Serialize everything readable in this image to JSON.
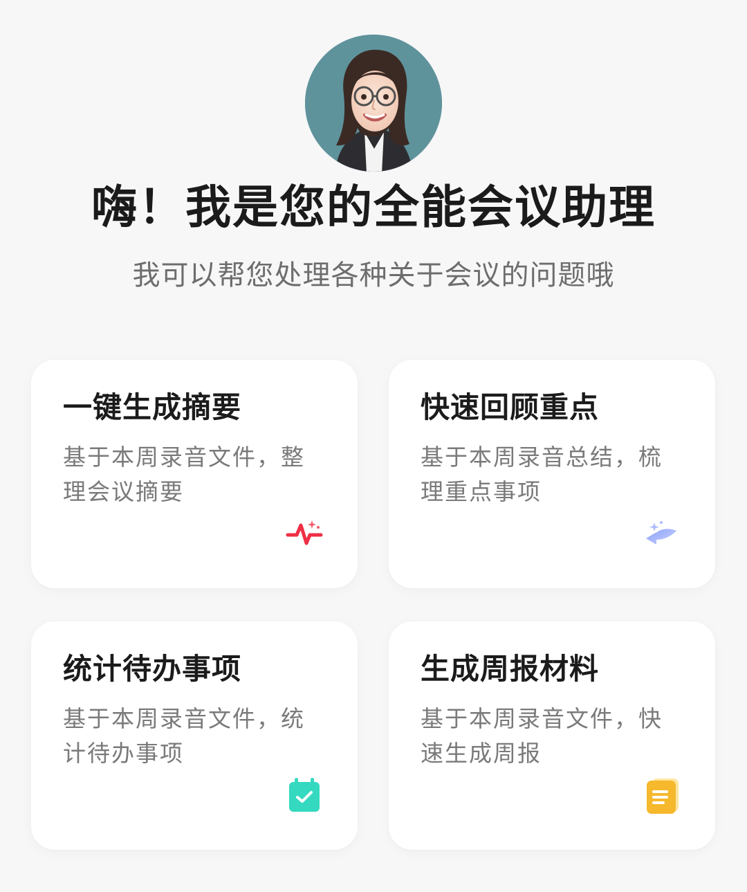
{
  "assistant": {
    "avatar_icon": "avatar-icon",
    "greeting": "嗨！我是您的全能会议助理",
    "subtitle": "我可以帮您处理各种关于会议的问题哦"
  },
  "cards": [
    {
      "title": "一键生成摘要",
      "description": "基于本周录音文件，整理会议摘要",
      "icon": "waveform-sparkle-icon",
      "accent": "#ef2f45"
    },
    {
      "title": "快速回顾重点",
      "description": "基于本周录音总结，梳理重点事项",
      "icon": "review-arrow-icon",
      "accent": "#8da0f4"
    },
    {
      "title": "统计待办事项",
      "description": "基于本周录音文件，统计待办事项",
      "icon": "calendar-check-icon",
      "accent": "#39dcc5"
    },
    {
      "title": "生成周报材料",
      "description": "基于本周录音文件，快速生成周报",
      "icon": "document-icon",
      "accent": "#f6b82c"
    }
  ],
  "colors": {
    "background": "#f7f7f8",
    "card": "#ffffff",
    "title": "#1b1b1b",
    "description": "#7a7a7a"
  }
}
